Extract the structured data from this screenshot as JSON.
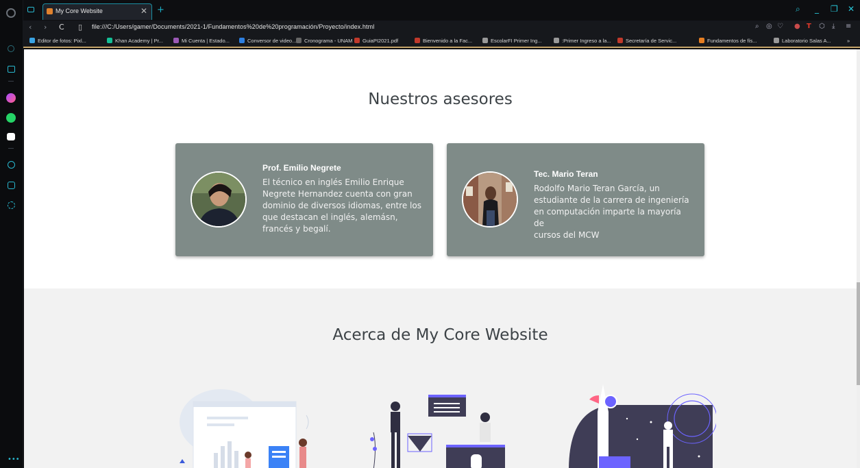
{
  "browser": {
    "tab_title": "My Core Website",
    "tab_close": "✕",
    "new_tab": "+",
    "url": "file:///C:/Users/gamer/Documents/2021-1/Fundamentos%20de%20programación/Proyecto/index.html",
    "bookmarks": [
      {
        "label": "Editor de fotos: Pixl...",
        "color": "#3aa3e3"
      },
      {
        "label": "Khan Academy | Pr...",
        "color": "#14bf96"
      },
      {
        "label": "Mi Cuenta | Estado...",
        "color": "#9b59b6"
      },
      {
        "label": "Conversor de video...",
        "color": "#2d7fe0"
      },
      {
        "label": "Cronograma - UNAM",
        "color": "#666666"
      },
      {
        "label": "GuiaPI2021.pdf",
        "color": "#c0392b"
      },
      {
        "label": "Bienvenido a la Fac...",
        "color": "#c0392b"
      },
      {
        "label": "EscolarFI Primer Ing...",
        "color": "#999999"
      },
      {
        "label": ":Primer Ingreso a la...",
        "color": "#999999"
      },
      {
        "label": "Secretaría de Servic...",
        "color": "#c0392b"
      },
      {
        "label": "Fundamentos de fís...",
        "color": "#e67e22"
      },
      {
        "label": "Laboratorio Salas A...",
        "color": "#999999"
      }
    ],
    "bookmarks_more": "»"
  },
  "page": {
    "advisors_title": "Nuestros asesores",
    "advisors": [
      {
        "name": "Prof. Emilio Negrete",
        "lines": [
          "El técnico en inglés Emilio Enrique",
          "Negrete Hernandez cuenta con gran",
          "dominio de diversos idiomas, entre los",
          "que destacan el inglés, alemásn,",
          "francés y begalí."
        ]
      },
      {
        "name": "Tec. Mario Teran",
        "lines": [
          "Rodolfo Mario Teran García, un",
          "estudiante de la carrera de ingeniería",
          "en computación imparte la mayoría de",
          "cursos del MCW"
        ]
      }
    ],
    "about_title": "Acerca de My Core Website"
  },
  "colors": {
    "card_bg": "#7f8b88",
    "accent": "#1bb0c8"
  }
}
